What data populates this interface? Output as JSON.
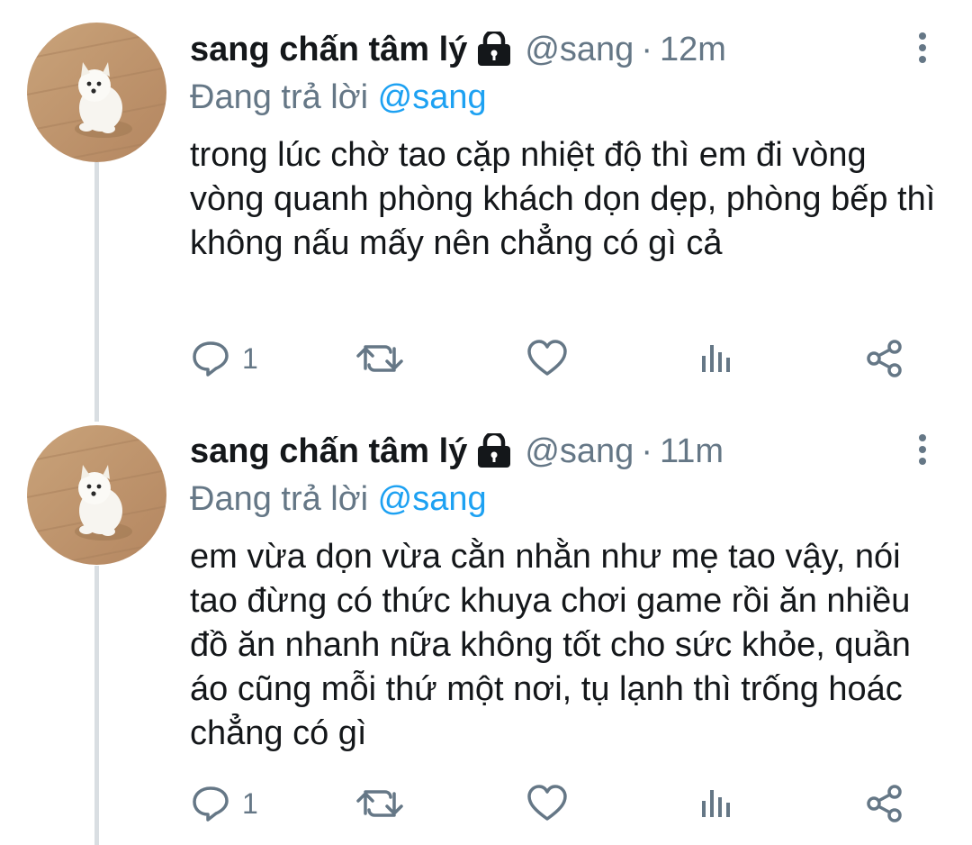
{
  "tweets": [
    {
      "display_name": "sang chấn tâm lý",
      "handle": "@sang",
      "separator": "·",
      "time": "12m",
      "replying_prefix": "Đang trả lời",
      "replying_to": "@sang",
      "text": "trong lúc chờ tao cặp nhiệt độ thì em đi vòng vòng quanh phòng khách dọn dẹp, phòng bếp thì không nấu mấy nên chẳng có gì cả",
      "reply_count": "1",
      "icons": {
        "lock": "lock-icon",
        "more": "more-vertical-icon",
        "reply": "reply-icon",
        "retweet": "retweet-icon",
        "like": "heart-icon",
        "analytics": "analytics-icon",
        "share": "share-icon"
      }
    },
    {
      "display_name": "sang chấn tâm lý",
      "handle": "@sang",
      "separator": "·",
      "time": "11m",
      "replying_prefix": "Đang trả lời",
      "replying_to": "@sang",
      "text": "em vừa dọn vừa cằn nhằn như mẹ tao vậy, nói tao đừng có thức khuya chơi game rồi ăn nhiều đồ ăn nhanh nữa không tốt cho sức khỏe, quần áo cũng mỗi thứ một nơi, tụ lạnh thì trống hoác chẳng có gì",
      "reply_count": "1",
      "icons": {
        "lock": "lock-icon",
        "more": "more-vertical-icon",
        "reply": "reply-icon",
        "retweet": "retweet-icon",
        "like": "heart-icon",
        "analytics": "analytics-icon",
        "share": "share-icon"
      }
    }
  ],
  "colors": {
    "link": "#1da1f2",
    "secondary_text": "#657786",
    "primary_text": "#14171a",
    "thread_line": "#d9dee2"
  }
}
